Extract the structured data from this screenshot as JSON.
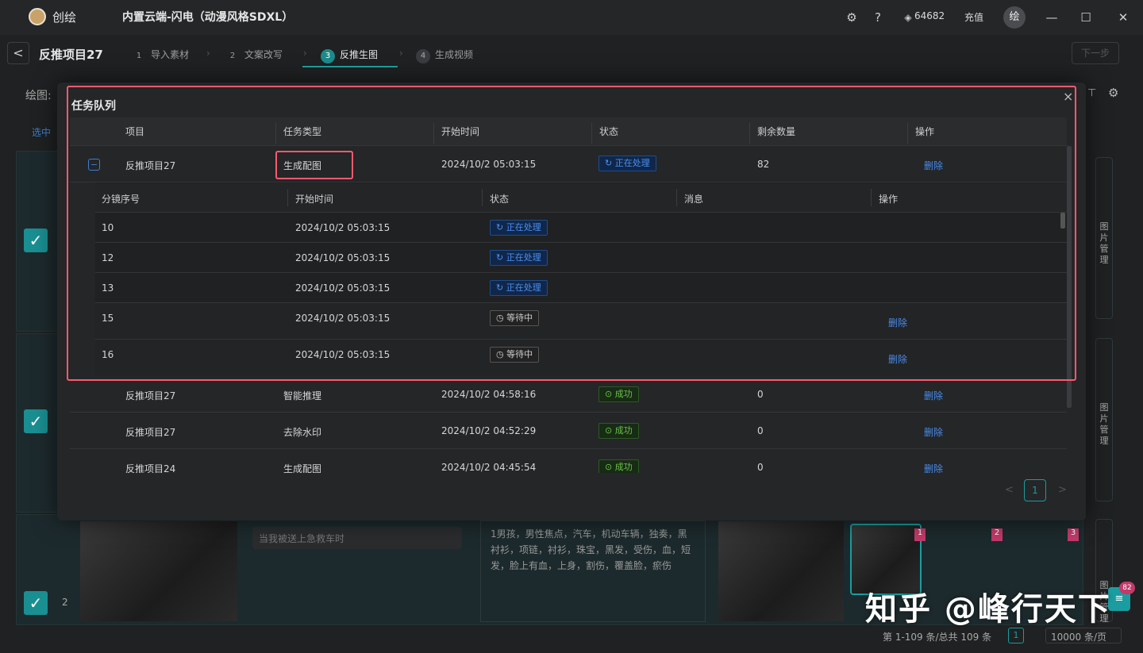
{
  "app": {
    "name": "创绘",
    "window_title": "内置云端-闪电（动漫风格SDXL）",
    "credits": "64682",
    "recharge": "充值",
    "avatar": "绘"
  },
  "header": {
    "back": "<",
    "project": "反推项目27",
    "next": "下一步",
    "draw_label": "绘图:",
    "steps": [
      {
        "num": "1",
        "label": "导入素材"
      },
      {
        "num": "2",
        "label": "文案改写"
      },
      {
        "num": "3",
        "label": "反推生图"
      },
      {
        "num": "4",
        "label": "生成视频"
      }
    ]
  },
  "background": {
    "select_label": "选中",
    "side_panel": "图片管理",
    "row_index": "2",
    "prompt_placeholder": "当我被送上急救车时",
    "tags": "1男孩，男性焦点，汽车，机动车辆，独奏，黑衬衫，项链，衬衫，珠宝，黑发，受伤，血，短发，脸上有血，上身，割伤，覆盖脸，瘀伤",
    "thumb_nums": [
      "1",
      "2",
      "3"
    ],
    "badge_count": "82",
    "footer_range": "第 1-109 条/总共 109 条",
    "footer_page": "1",
    "footer_per_page": "10000 条/页"
  },
  "modal": {
    "title": "任务队列",
    "close": "×",
    "columns": [
      "项目",
      "任务类型",
      "开始时间",
      "状态",
      "剩余数量",
      "操作"
    ],
    "expanded": {
      "project": "反推项目27",
      "type": "生成配图",
      "start": "2024/10/2 05:03:15",
      "status": "正在处理",
      "remaining": "82",
      "action": "删除",
      "toggle": "−"
    },
    "sub_columns": [
      "分镜序号",
      "开始时间",
      "状态",
      "消息",
      "操作"
    ],
    "sub_rows": [
      {
        "idx": "10",
        "start": "2024/10/2 05:03:15",
        "status": "正在处理",
        "kind": "proc",
        "action": ""
      },
      {
        "idx": "12",
        "start": "2024/10/2 05:03:15",
        "status": "正在处理",
        "kind": "proc",
        "action": ""
      },
      {
        "idx": "13",
        "start": "2024/10/2 05:03:15",
        "status": "正在处理",
        "kind": "proc",
        "action": ""
      },
      {
        "idx": "15",
        "start": "2024/10/2 05:03:15",
        "status": "等待中",
        "kind": "wait",
        "action": "删除"
      },
      {
        "idx": "16",
        "start": "2024/10/2 05:03:15",
        "status": "等待中",
        "kind": "wait",
        "action": "删除"
      }
    ],
    "rows": [
      {
        "project": "反推项目27",
        "type": "智能推理",
        "start": "2024/10/2 04:58:16",
        "status": "成功",
        "remaining": "0",
        "action": "删除"
      },
      {
        "project": "反推项目27",
        "type": "去除水印",
        "start": "2024/10/2 04:52:29",
        "status": "成功",
        "remaining": "0",
        "action": "删除"
      },
      {
        "project": "反推项目24",
        "type": "生成配图",
        "start": "2024/10/2 04:45:54",
        "status": "成功",
        "remaining": "0",
        "action": "删除"
      }
    ],
    "page_current": "1",
    "prev": "<",
    "next": ">"
  },
  "watermark": "知乎 @峰行天下"
}
